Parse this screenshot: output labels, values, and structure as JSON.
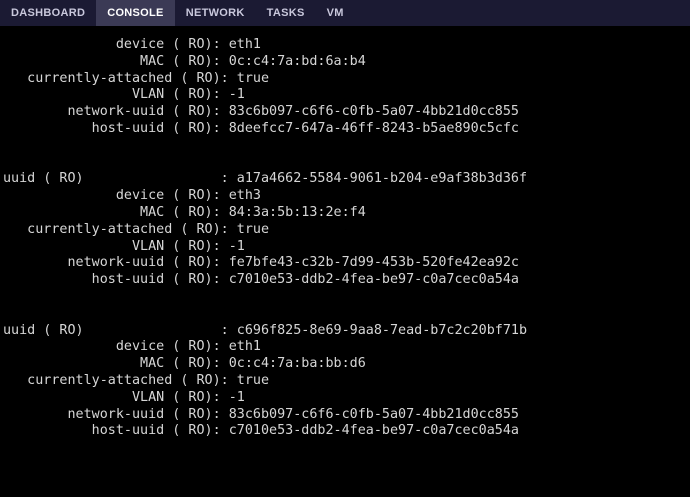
{
  "tabs": [
    {
      "label": "DASHBOARD",
      "active": false
    },
    {
      "label": "CONSOLE",
      "active": true
    },
    {
      "label": "NETWORK",
      "active": false
    },
    {
      "label": "TASKS",
      "active": false
    },
    {
      "label": "VM",
      "active": false
    }
  ],
  "console": {
    "lines": [
      "              device ( RO): eth1",
      "                 MAC ( RO): 0c:c4:7a:bd:6a:b4",
      "   currently-attached ( RO): true",
      "                VLAN ( RO): -1",
      "        network-uuid ( RO): 83c6b097-c6f6-c0fb-5a07-4bb21d0cc855",
      "           host-uuid ( RO): 8deefcc7-647a-46ff-8243-b5ae890c5cfc",
      "",
      "",
      "uuid ( RO)                 : a17a4662-5584-9061-b204-e9af38b3d36f",
      "              device ( RO): eth3",
      "                 MAC ( RO): 84:3a:5b:13:2e:f4",
      "   currently-attached ( RO): true",
      "                VLAN ( RO): -1",
      "        network-uuid ( RO): fe7bfe43-c32b-7d99-453b-520fe42ea92c",
      "           host-uuid ( RO): c7010e53-ddb2-4fea-be97-c0a7cec0a54a",
      "",
      "",
      "uuid ( RO)                 : c696f825-8e69-9aa8-7ead-b7c2c20bf71b",
      "              device ( RO): eth1",
      "                 MAC ( RO): 0c:c4:7a:ba:bb:d6",
      "   currently-attached ( RO): true",
      "                VLAN ( RO): -1",
      "        network-uuid ( RO): 83c6b097-c6f6-c0fb-5a07-4bb21d0cc855",
      "           host-uuid ( RO): c7010e53-ddb2-4fea-be97-c0a7cec0a54a"
    ]
  }
}
